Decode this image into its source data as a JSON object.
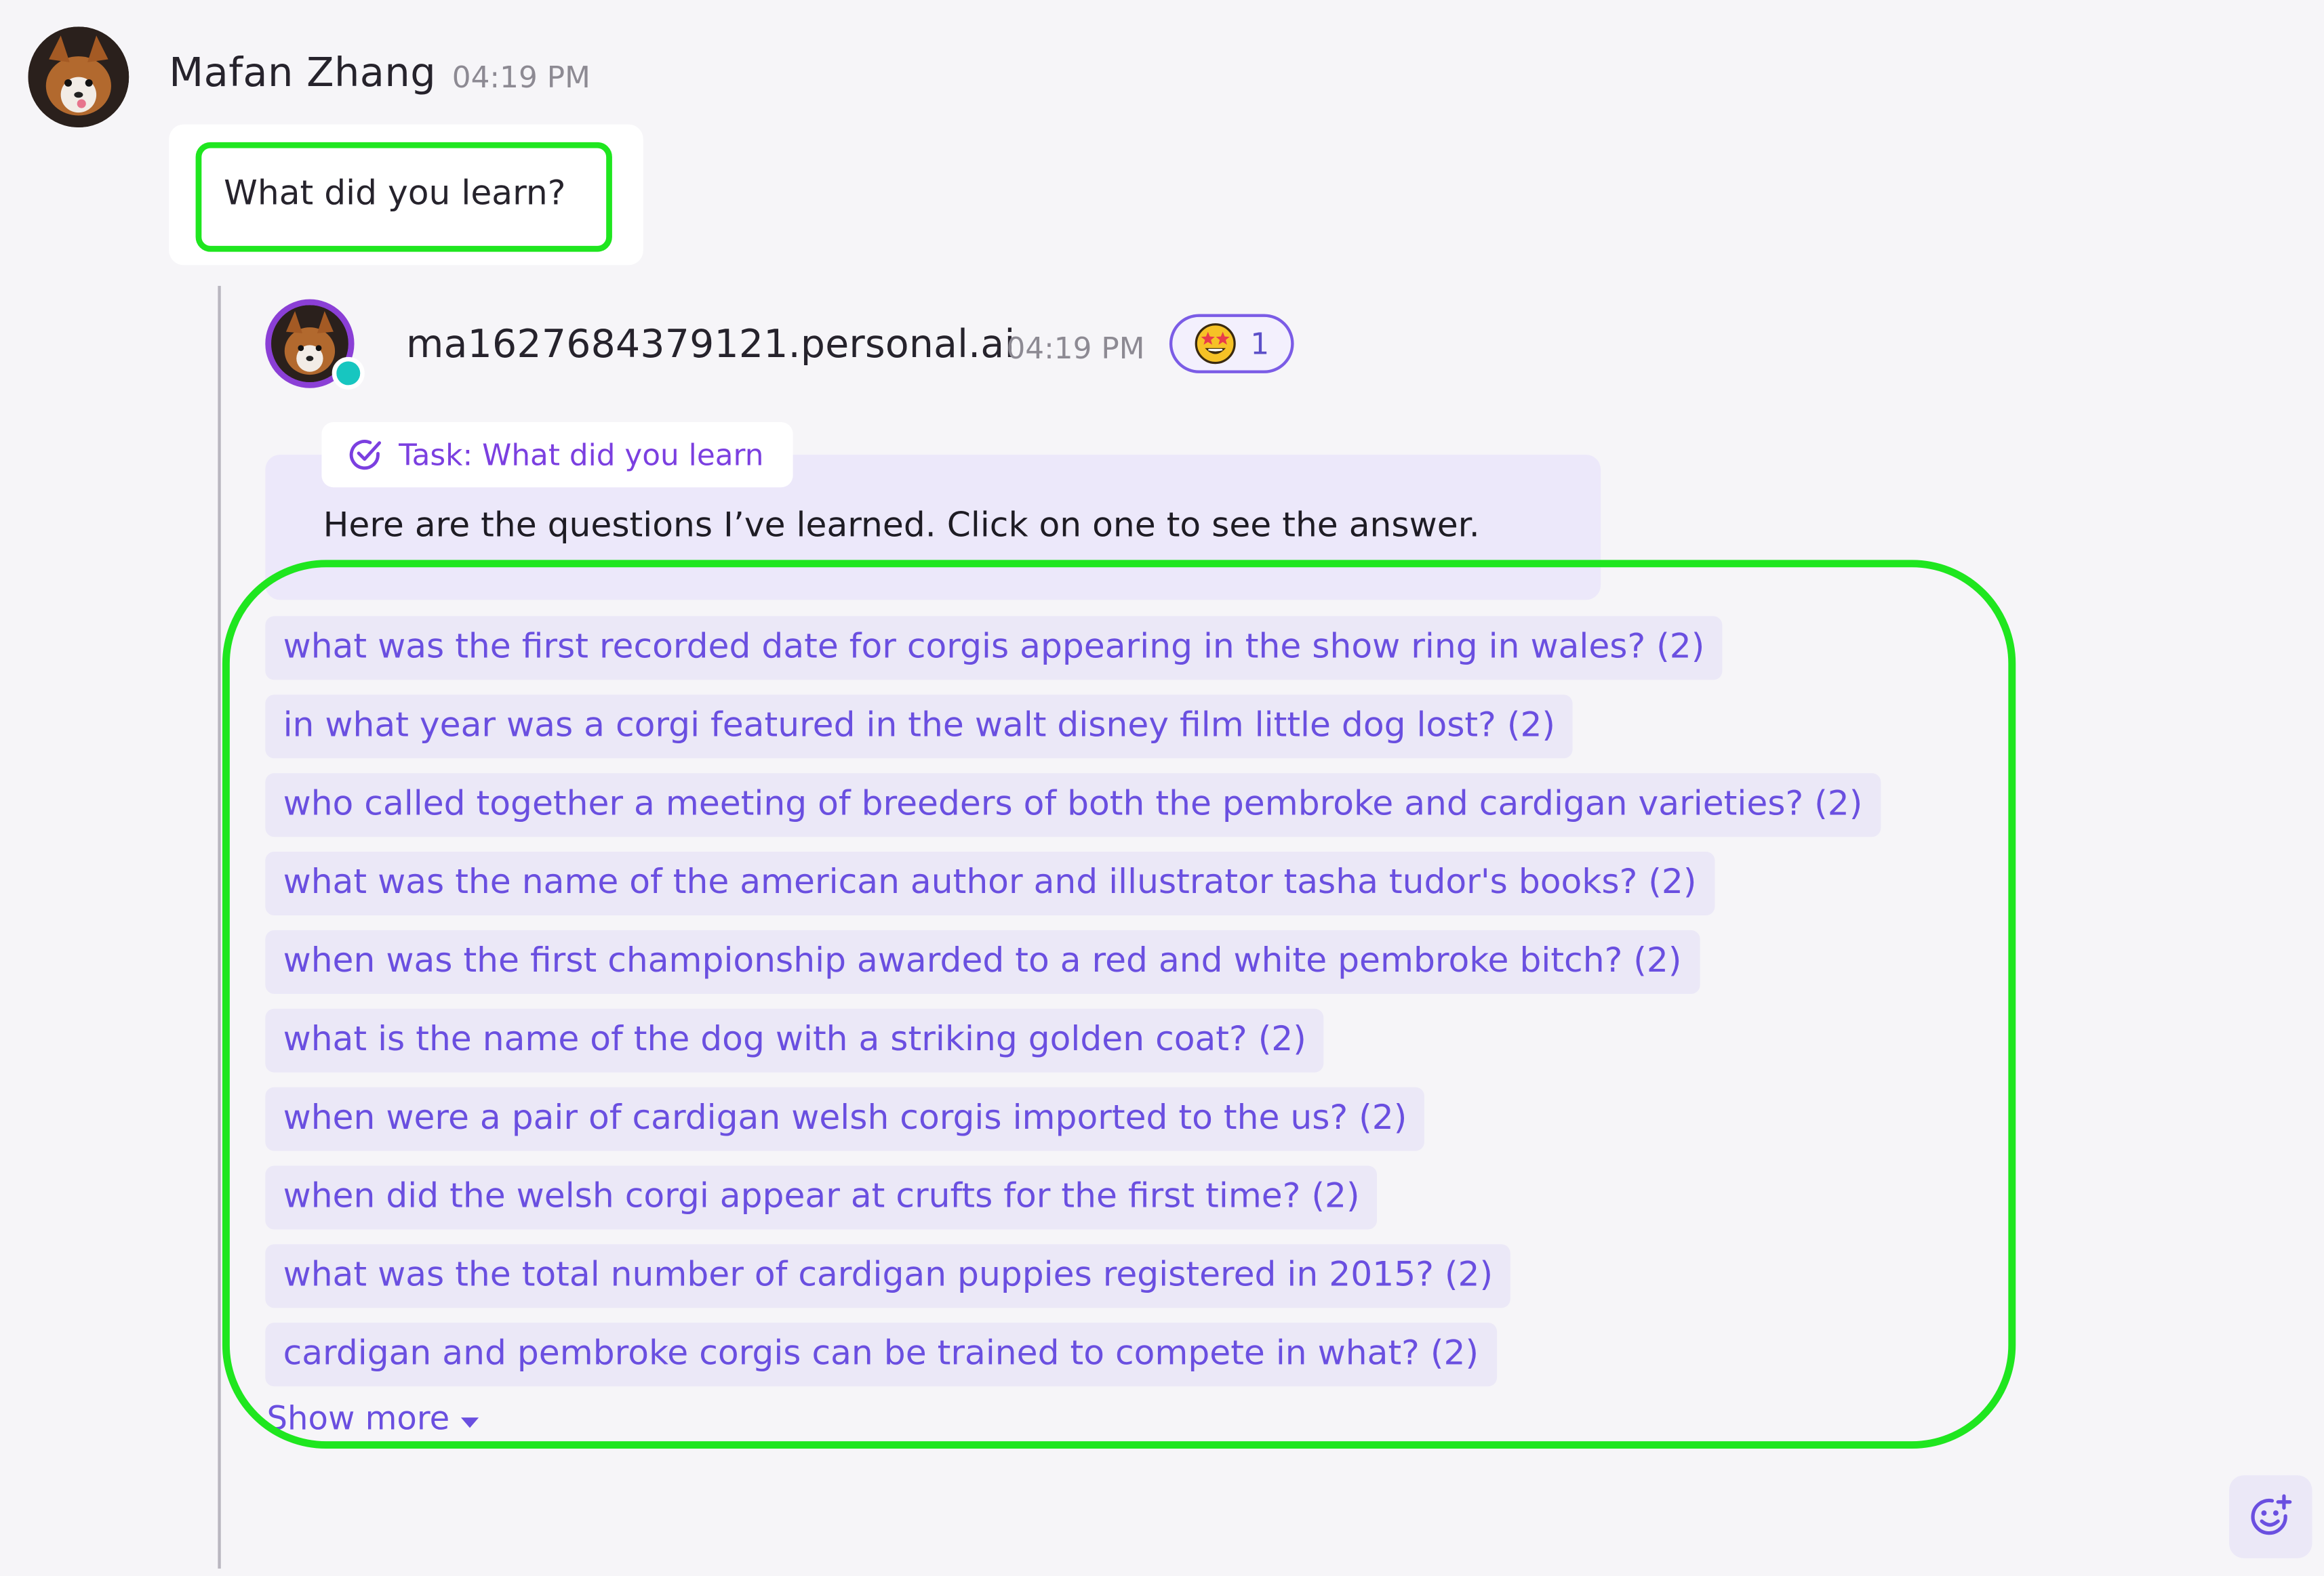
{
  "message": {
    "author": "Mafan Zhang",
    "time": "04:19 PM",
    "text": "What did you learn?"
  },
  "reply": {
    "author": "ma1627684379121.personal.ai",
    "time": "04:19 PM",
    "reaction": {
      "emoji": "star-struck",
      "count": "1"
    },
    "task_label": "Task: What did you learn",
    "intro": "Here are the questions I’ve learned. Click on one to see the answer.",
    "questions": [
      "what was the first recorded date for corgis appearing in the show ring in wales? (2)",
      "in what year was a corgi featured in the walt disney film little dog lost? (2)",
      "who called together a meeting of breeders of both the pembroke and cardigan varieties? (2)",
      "what was the name of the american author and illustrator tasha tudor's books? (2)",
      "when was the first championship awarded to a red and white pembroke bitch? (2)",
      "what is the name of the dog with a striking golden coat? (2)",
      "when were a pair of cardigan welsh corgis imported to the us? (2)",
      "when did the welsh corgi appear at crufts for the first time? (2)",
      "what was the total number of cardigan puppies registered in 2015? (2)",
      "cardigan and pembroke corgis can be trained to compete in what? (2)"
    ],
    "show_more": "Show more"
  },
  "colors": {
    "accent": "#6a4fe0",
    "highlight": "#1fe61f",
    "online": "#17c6c0",
    "ring": "#8b3fd6"
  }
}
